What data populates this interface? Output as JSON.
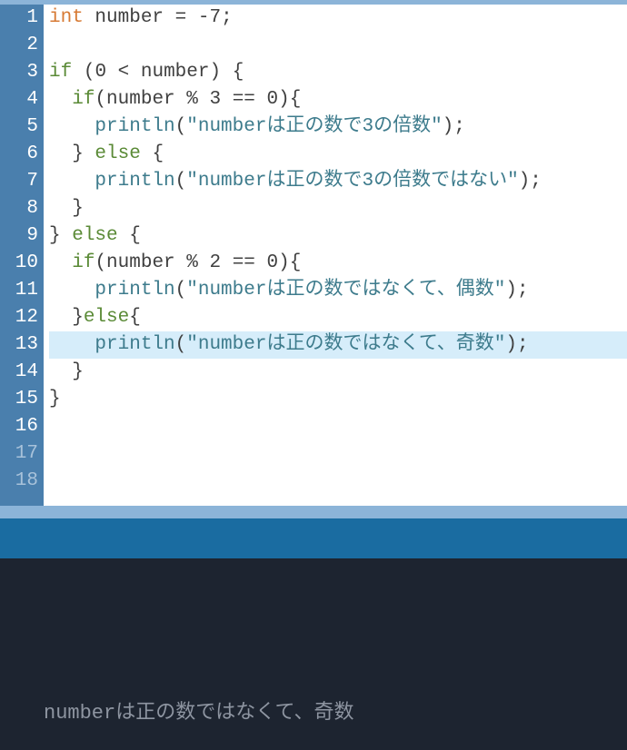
{
  "editor": {
    "highlighted_line": 13,
    "visible_line_count": 18,
    "gutter_lines": [
      "1",
      "2",
      "3",
      "4",
      "5",
      "6",
      "7",
      "8",
      "9",
      "10",
      "11",
      "12",
      "13",
      "14",
      "15",
      "16",
      "17",
      "18"
    ],
    "lines": [
      {
        "n": 1,
        "tokens": [
          {
            "cls": "tok-type",
            "t": "int"
          },
          {
            "cls": "tok-op",
            "t": " "
          },
          {
            "cls": "tok-ident",
            "t": "number"
          },
          {
            "cls": "tok-op",
            "t": " = -"
          },
          {
            "cls": "tok-num",
            "t": "7"
          },
          {
            "cls": "tok-punct",
            "t": ";"
          }
        ]
      },
      {
        "n": 2,
        "tokens": []
      },
      {
        "n": 3,
        "tokens": [
          {
            "cls": "tok-kw",
            "t": "if"
          },
          {
            "cls": "tok-op",
            "t": " ("
          },
          {
            "cls": "tok-num",
            "t": "0"
          },
          {
            "cls": "tok-op",
            "t": " < "
          },
          {
            "cls": "tok-ident",
            "t": "number"
          },
          {
            "cls": "tok-op",
            "t": ") {"
          }
        ]
      },
      {
        "n": 4,
        "tokens": [
          {
            "cls": "tok-op",
            "t": "  "
          },
          {
            "cls": "tok-kw",
            "t": "if"
          },
          {
            "cls": "tok-op",
            "t": "("
          },
          {
            "cls": "tok-ident",
            "t": "number"
          },
          {
            "cls": "tok-op",
            "t": " % "
          },
          {
            "cls": "tok-num",
            "t": "3"
          },
          {
            "cls": "tok-op",
            "t": " == "
          },
          {
            "cls": "tok-num",
            "t": "0"
          },
          {
            "cls": "tok-op",
            "t": "){"
          }
        ]
      },
      {
        "n": 5,
        "tokens": [
          {
            "cls": "tok-op",
            "t": "    "
          },
          {
            "cls": "tok-fn",
            "t": "println"
          },
          {
            "cls": "tok-op",
            "t": "("
          },
          {
            "cls": "tok-str",
            "t": "\"numberは正の数で3の倍数\""
          },
          {
            "cls": "tok-op",
            "t": ");"
          }
        ]
      },
      {
        "n": 6,
        "tokens": [
          {
            "cls": "tok-op",
            "t": "  } "
          },
          {
            "cls": "tok-kw",
            "t": "else"
          },
          {
            "cls": "tok-op",
            "t": " {"
          }
        ]
      },
      {
        "n": 7,
        "tokens": [
          {
            "cls": "tok-op",
            "t": "    "
          },
          {
            "cls": "tok-fn",
            "t": "println"
          },
          {
            "cls": "tok-op",
            "t": "("
          },
          {
            "cls": "tok-str",
            "t": "\"numberは正の数で3の倍数ではない\""
          },
          {
            "cls": "tok-op",
            "t": ");"
          }
        ]
      },
      {
        "n": 8,
        "tokens": [
          {
            "cls": "tok-op",
            "t": "  }"
          }
        ]
      },
      {
        "n": 9,
        "tokens": [
          {
            "cls": "tok-op",
            "t": "} "
          },
          {
            "cls": "tok-kw",
            "t": "else"
          },
          {
            "cls": "tok-op",
            "t": " {"
          }
        ]
      },
      {
        "n": 10,
        "tokens": [
          {
            "cls": "tok-op",
            "t": "  "
          },
          {
            "cls": "tok-kw",
            "t": "if"
          },
          {
            "cls": "tok-op",
            "t": "("
          },
          {
            "cls": "tok-ident",
            "t": "number"
          },
          {
            "cls": "tok-op",
            "t": " % "
          },
          {
            "cls": "tok-num",
            "t": "2"
          },
          {
            "cls": "tok-op",
            "t": " == "
          },
          {
            "cls": "tok-num",
            "t": "0"
          },
          {
            "cls": "tok-op",
            "t": "){"
          }
        ]
      },
      {
        "n": 11,
        "tokens": [
          {
            "cls": "tok-op",
            "t": "    "
          },
          {
            "cls": "tok-fn",
            "t": "println"
          },
          {
            "cls": "tok-op",
            "t": "("
          },
          {
            "cls": "tok-str",
            "t": "\"numberは正の数ではなくて、偶数\""
          },
          {
            "cls": "tok-op",
            "t": ");"
          }
        ]
      },
      {
        "n": 12,
        "tokens": [
          {
            "cls": "tok-op",
            "t": "  }"
          },
          {
            "cls": "tok-kw",
            "t": "else"
          },
          {
            "cls": "tok-op",
            "t": "{"
          }
        ]
      },
      {
        "n": 13,
        "tokens": [
          {
            "cls": "tok-op",
            "t": "    "
          },
          {
            "cls": "tok-fn",
            "t": "println"
          },
          {
            "cls": "tok-op",
            "t": "("
          },
          {
            "cls": "tok-str",
            "t": "\"numberは正の数ではなくて、奇数\""
          },
          {
            "cls": "tok-op",
            "t": ");"
          }
        ]
      },
      {
        "n": 14,
        "tokens": [
          {
            "cls": "tok-op",
            "t": "  }"
          }
        ]
      },
      {
        "n": 15,
        "tokens": [
          {
            "cls": "tok-op",
            "t": "}"
          }
        ]
      },
      {
        "n": 16,
        "tokens": []
      },
      {
        "n": 17,
        "tokens": []
      },
      {
        "n": 18,
        "tokens": []
      }
    ]
  },
  "console": {
    "output": "numberは正の数ではなくて、奇数"
  },
  "colors": {
    "gutter_bg": "#4a7fad",
    "gutter_fg": "#ffffff",
    "editor_bg": "#ffffff",
    "highlight_bg": "#d6edfa",
    "divider_light": "#8cb4d8",
    "divider_dark": "#1a6ca1",
    "console_bg": "#1d2430",
    "console_fg": "#8e95a1",
    "tok_type": "#d77a34",
    "tok_kw": "#5a8a36",
    "tok_fn": "#3d7b8c",
    "tok_str": "#3d7b8c"
  }
}
